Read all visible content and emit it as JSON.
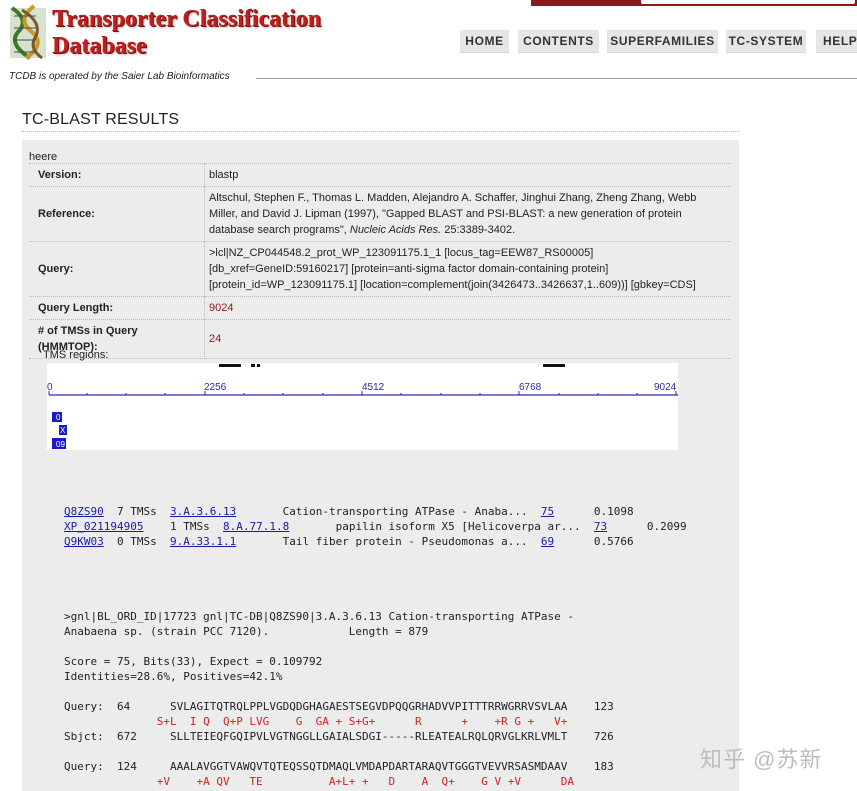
{
  "header": {
    "logo_line1": "Transporter Classification",
    "logo_line2": "Database",
    "operated_by": "TCDB is operated by the Saier Lab Bioinformatics"
  },
  "nav": [
    {
      "label": "HOME"
    },
    {
      "label": "CONTENTS"
    },
    {
      "label": "SUPERFAMILIES"
    },
    {
      "label": "TC-SYSTEM"
    },
    {
      "label": "HELP"
    }
  ],
  "page_title": "TC-BLAST RESULTS",
  "query_name": "heere",
  "info": {
    "version_label": "Version:",
    "version_value": "blastp",
    "reference_label": "Reference:",
    "reference_value_pre": "Altschul, Stephen F., Thomas L. Madden, Alejandro A. Schaffer, Jinghui Zhang, Zheng Zhang, Webb Miller, and David J. Lipman (1997), \"Gapped BLAST and PSI-BLAST: a new generation of protein database search programs\",",
    "reference_journal": "Nucleic Acids Res.",
    "reference_value_post": "25:3389-3402.",
    "query_label": "Query:",
    "query_value": ">lcl|NZ_CP044548.2_prot_WP_123091175.1_1 [locus_tag=EEW87_RS00005] [db_xref=GeneID:59160217] [protein=anti-sigma factor domain-containing protein] [protein_id=WP_123091175.1] [location=complement(join(3426473..3426637,1..609))] [gbkey=CDS]",
    "length_label": "Query Length:",
    "length_value": "9024",
    "tms_label": "# of TMSs in Query (HMMTOP):",
    "tms_value": "24"
  },
  "tms_regions": {
    "label": "TMS regions:",
    "axis_ticks": [
      "0",
      "2256",
      "4512",
      "6768",
      "9024"
    ],
    "hit_tags": [
      "0",
      "X",
      "09"
    ]
  },
  "hits": [
    {
      "acc": "Q8ZS90",
      "tms": "7 TMSs",
      "tc": "3.A.3.6.13",
      "desc": "Cation-transporting ATPase - Anaba...",
      "score": "75",
      "evalue": "0.1098"
    },
    {
      "acc": "XP_021194905",
      "tms": "1 TMSs",
      "tc": "8.A.77.1.8",
      "desc": "papilin isoform X5 [Helicoverpa ar...",
      "score": "73",
      "evalue": "0.2099"
    },
    {
      "acc": "Q9KW03",
      "tms": "0 TMSs",
      "tc": "9.A.33.1.1",
      "desc": "Tail fiber protein - Pseudomonas a...",
      "score": "69",
      "evalue": "0.5766"
    }
  ],
  "alignment": {
    "header_line1": ">gnl|BL_ORD_ID|17723 gnl|TC-DB|Q8ZS90|3.A.3.6.13 Cation-transporting ATPase -",
    "header_line2": "Anabaena sp. (strain PCC 7120).            Length = 879",
    "score_line": "Score = 75, Bits(33), Expect = 0.109792",
    "identities_line": "Identities=28.6%, Positives=42.1%",
    "blocks": [
      {
        "q_label": "Query:",
        "q_start": "64",
        "q_seq": "SVLAGITQTRQLPPLVGDQDGHAGAESTSEGVDPQQGRHADVVPITTTRRWGRRVSVLAA",
        "q_end": "123",
        "mid": "S+L  I Q  Q+P LVG    G  GA + S+G+      R      +    +R G +   V+",
        "s_label": "Sbjct:",
        "s_start": "672",
        "s_seq": "SLLTEIEQFGQIPVLVGTNGGLLGAIALSDGI-----RLEATEALRQLQRVGLKRLVMLT",
        "s_end": "726"
      },
      {
        "q_label": "Query:",
        "q_start": "124",
        "q_seq": "AAALAVGGTVAWQVTQTEQSSQTDMAQLVMDAPDARTARAQVTGGGTVEVVRSASMDAAV",
        "q_end": "183",
        "mid": "+V    +A QV   TE          A+L+ +   D    A  Q+    G V +V      DA"
      }
    ]
  },
  "watermark": "知乎 @苏新",
  "colors": {
    "brand_red": "#c0201c",
    "dark_red": "#8b1a1a",
    "link": "#1a1aa6",
    "panel": "#ececec",
    "mismatch": "#d42020"
  }
}
